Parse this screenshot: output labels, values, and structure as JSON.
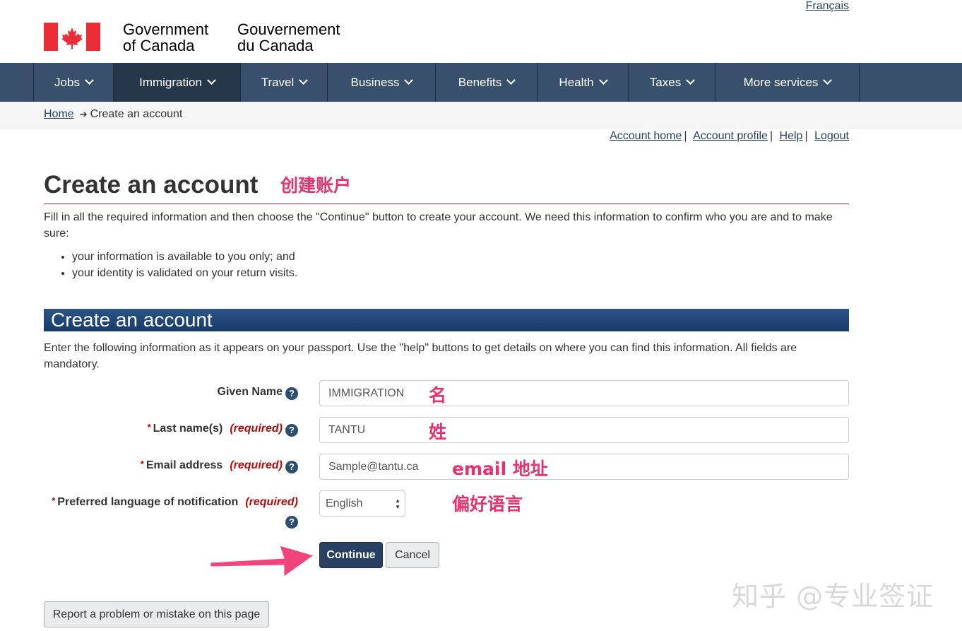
{
  "header": {
    "lang_toggle": "Français",
    "gov_en_line1": "Government",
    "gov_en_line2": "of Canada",
    "gov_fr_line1": "Gouvernement",
    "gov_fr_line2": "du Canada",
    "flag_icon": "canada-flag-icon"
  },
  "nav": {
    "items": [
      {
        "label": "Jobs"
      },
      {
        "label": "Immigration",
        "active": true
      },
      {
        "label": "Travel"
      },
      {
        "label": "Business"
      },
      {
        "label": "Benefits"
      },
      {
        "label": "Health"
      },
      {
        "label": "Taxes"
      },
      {
        "label": "More services"
      }
    ]
  },
  "breadcrumb": {
    "home": "Home",
    "current": "Create an account"
  },
  "account_links": {
    "home": "Account home",
    "profile": "Account profile",
    "help": "Help",
    "logout": "Logout"
  },
  "page": {
    "title": "Create an account",
    "title_annotation": "创建账户",
    "intro": "Fill in all the required information and then choose the \"Continue\" button to create your account. We need this information to confirm who you are and to make sure:",
    "bullets": [
      "your information is available to you only; and",
      "your identity is validated on your return visits."
    ]
  },
  "form": {
    "heading": "Create an account",
    "intro": "Enter the following information as it appears on your passport. Use the \"help\" buttons to get details on where you can find this information. All fields are mandatory.",
    "required_text": "(required)",
    "required_star": "*",
    "help_glyph": "?",
    "given_name": {
      "label": "Given Name",
      "value": "IMMIGRATION",
      "annotation": "名"
    },
    "last_name": {
      "label": "Last name(s)",
      "value": "TANTU",
      "annotation": "姓"
    },
    "email": {
      "label": "Email address",
      "value": "Sample@tantu.ca",
      "annotation": "email 地址"
    },
    "language": {
      "label": "Preferred language of notification",
      "value": "English",
      "annotation": "偏好语言"
    },
    "continue_label": "Continue",
    "cancel_label": "Cancel",
    "report_label": "Report a problem or mistake on this page"
  },
  "watermark": "知乎 @专业签证",
  "colors": {
    "nav_bg": "#38506b",
    "nav_active": "#26374a",
    "panel_head": "#1f4677",
    "annotation": "#e8316d",
    "required": "#b20c0c",
    "flag_red": "#eb2d37"
  }
}
